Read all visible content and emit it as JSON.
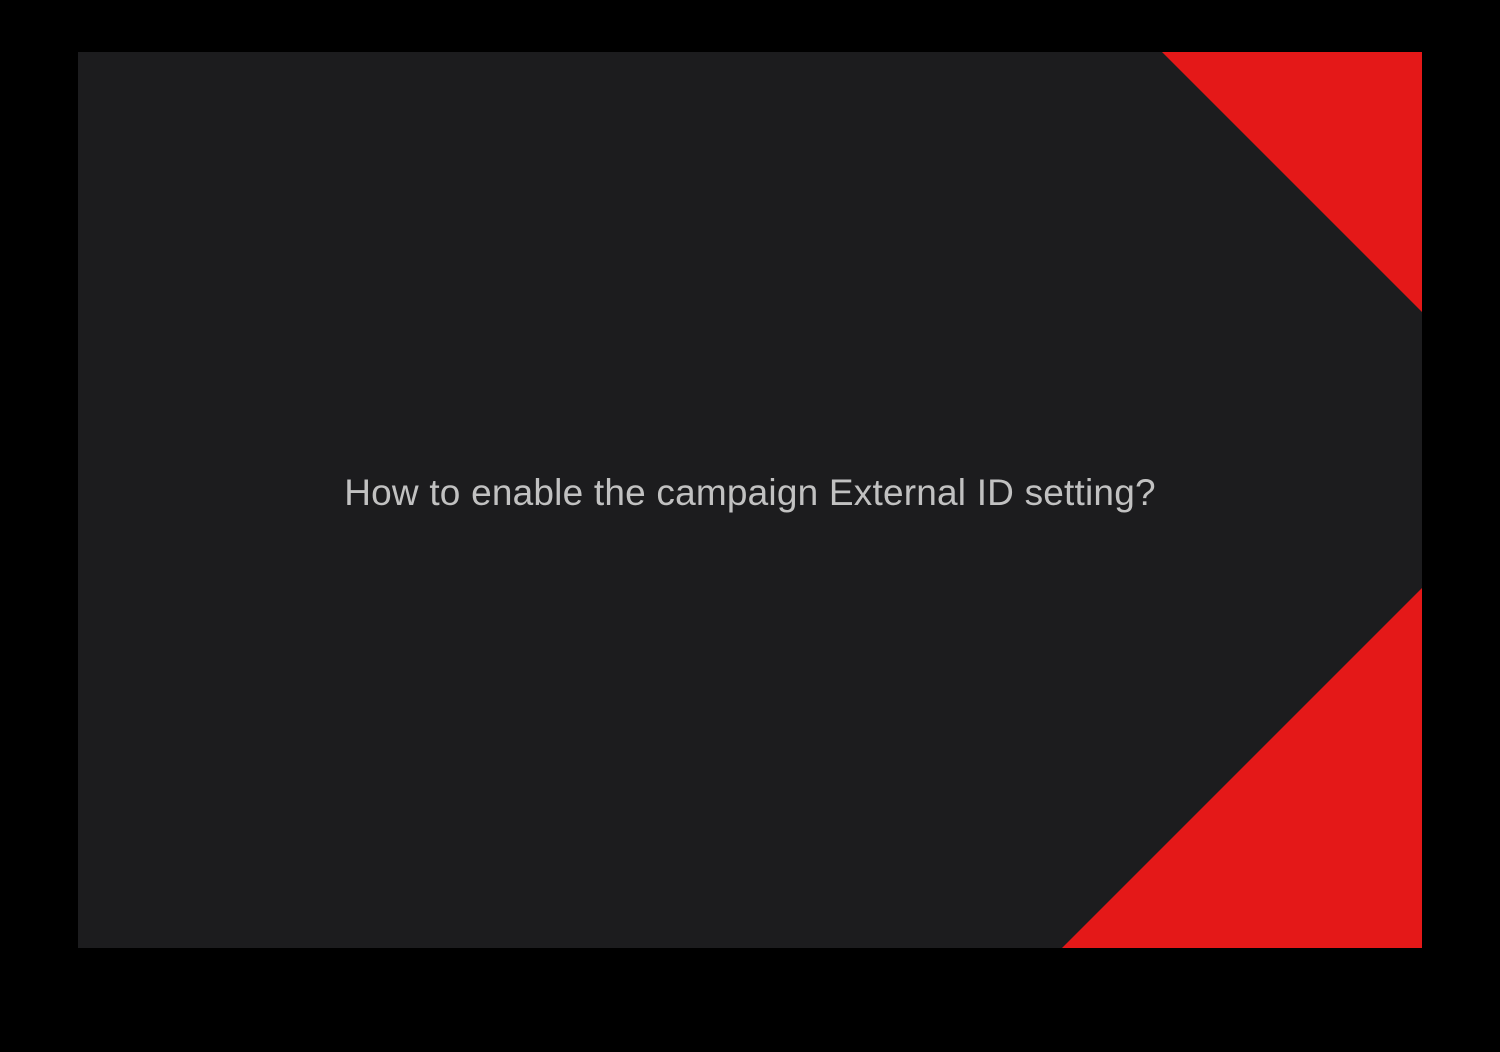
{
  "slide": {
    "title": "How to enable the campaign External ID setting?"
  },
  "colors": {
    "background": "#1c1c1e",
    "accent": "#e41818",
    "text": "#c1c1c1"
  }
}
